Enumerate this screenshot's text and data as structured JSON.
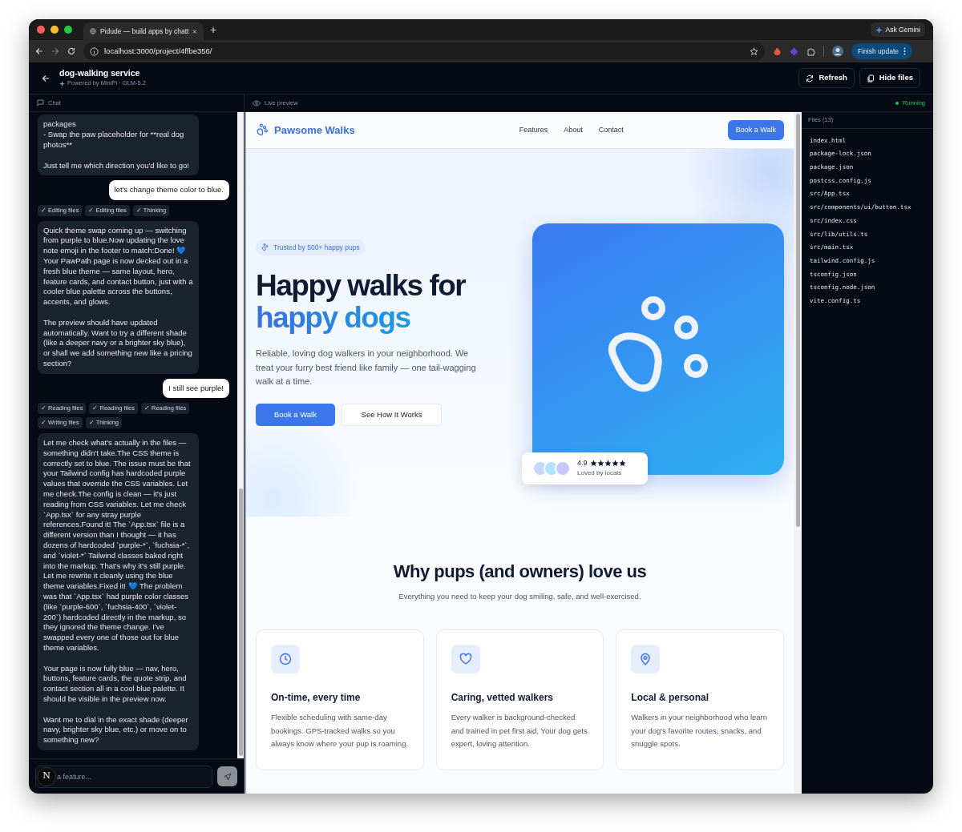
{
  "browser": {
    "tab_title": "Pidude — build apps by chatt",
    "new_tab": "+",
    "url": "localhost:3000/project/4ffbe356/",
    "ask_gemini": "Ask Gemini",
    "finish_update": "Finish update"
  },
  "app": {
    "title": "dog-walking service",
    "subtitle": "Powered by MiniPi · GLM-5.2",
    "buttons": [
      {
        "label": "Refresh",
        "kind": "refresh"
      },
      {
        "label": "Hide files",
        "kind": "files"
      }
    ]
  },
  "panels": {
    "chat_label": "Chat",
    "preview_label": "Live preview",
    "status": "Running"
  },
  "chat": {
    "messages": [
      {
        "kind": "assistant",
        "text": "packages\n- Swap the paw placeholder for **real dog photos**\n\nJust tell me which direction you'd like to go!"
      },
      {
        "kind": "user",
        "text": "let's change theme color to blue."
      },
      {
        "kind": "steps",
        "items": [
          "✓ Editing files",
          "✓ Editing files",
          "✓ Thinking"
        ]
      },
      {
        "kind": "assistant",
        "text": "Quick theme swap coming up — switching from purple to blue.Now updating the love note emoji in the footer to match:Done! 💙 Your PawPath page is now decked out in a fresh blue theme — same layout, hero, feature cards, and contact button, just with a cooler blue palette across the buttons, accents, and glows.\n\nThe preview should have updated automatically. Want to try a different shade (like a deeper navy or a brighter sky blue), or shall we add something new like a pricing section?"
      },
      {
        "kind": "user",
        "text": "I still see purple!"
      },
      {
        "kind": "steps",
        "items": [
          "✓ Reading files",
          "✓ Reading files",
          "✓ Reading files",
          "✓ Writing files",
          "✓ Thinking"
        ]
      },
      {
        "kind": "assistant",
        "text": "Let me check what's actually in the files — something didn't take.The CSS theme is correctly set to blue. The issue must be that your Tailwind config has hardcoded purple values that override the CSS variables. Let me check.The config is clean — it's just reading from CSS variables. Let me check `App.tsx` for any stray purple references.Found it! The `App.tsx` file is a different version than I thought — it has dozens of hardcoded `purple-*`, `fuchsia-*`, and `violet-*` Tailwind classes baked right into the markup. That's why it's still purple. Let me rewrite it cleanly using the blue theme variables.Fixed it! 💙 The problem was that `App.tsx` had purple color classes (like `purple-600`, `fuchsia-400`, `violet-200`) hardcoded directly in the markup, so they ignored the theme change. I've swapped every one of those out for blue theme variables.\n\nYour page is now fully blue — nav, hero, buttons, feature cards, the quote strip, and contact section all in a cool blue palette. It should be visible in the preview now.\n\nWant me to dial in the exact shade (deeper navy, brighter sky blue, etc.) or move on to something new?"
      }
    ],
    "avatar_letter": "N",
    "placeholder": "a feature..."
  },
  "site": {
    "brand": "Pawsome Walks",
    "nav": [
      "Features",
      "About",
      "Contact"
    ],
    "cta": "Book a Walk",
    "badge": "Trusted by 500+ happy pups",
    "headline": "Happy walks for",
    "headline_accent": "happy dogs",
    "intro": "Reliable, loving dog walkers in your neighborhood. We treat your furry best friend like family — one tail-wagging walk at a time.",
    "primary_button": "Book a Walk",
    "secondary_button": "See How It Works",
    "rating": "4.9",
    "stars": 5,
    "rating_caption": "Loved by locals",
    "section_title": "Why pups (and owners) love us",
    "section_subtitle": "Everything you need to keep your dog smiling, safe, and well-exercised.",
    "features": [
      {
        "kind": "clock",
        "title": "On-time, every time",
        "text": "Flexible scheduling with same-day bookings. GPS-tracked walks so you always know where your pup is roaming."
      },
      {
        "kind": "heart",
        "title": "Caring, vetted walkers",
        "text": "Every walker is background-checked and trained in pet first aid. Your dog gets expert, loving attention."
      },
      {
        "kind": "pin",
        "title": "Local & personal",
        "text": "Walkers in your neighborhood who learn your dog's favorite routes, snacks, and snuggle spots."
      }
    ]
  },
  "files": {
    "header": "Files (13)",
    "items": [
      "index.html",
      "package-lock.json",
      "package.json",
      "postcss.config.js",
      "src/App.tsx",
      "src/components/ui/button.tsx",
      "src/index.css",
      "src/lib/utils.ts",
      "src/main.tsx",
      "tailwind.config.js",
      "tsconfig.json",
      "tsconfig.node.json",
      "vite.config.ts"
    ]
  }
}
